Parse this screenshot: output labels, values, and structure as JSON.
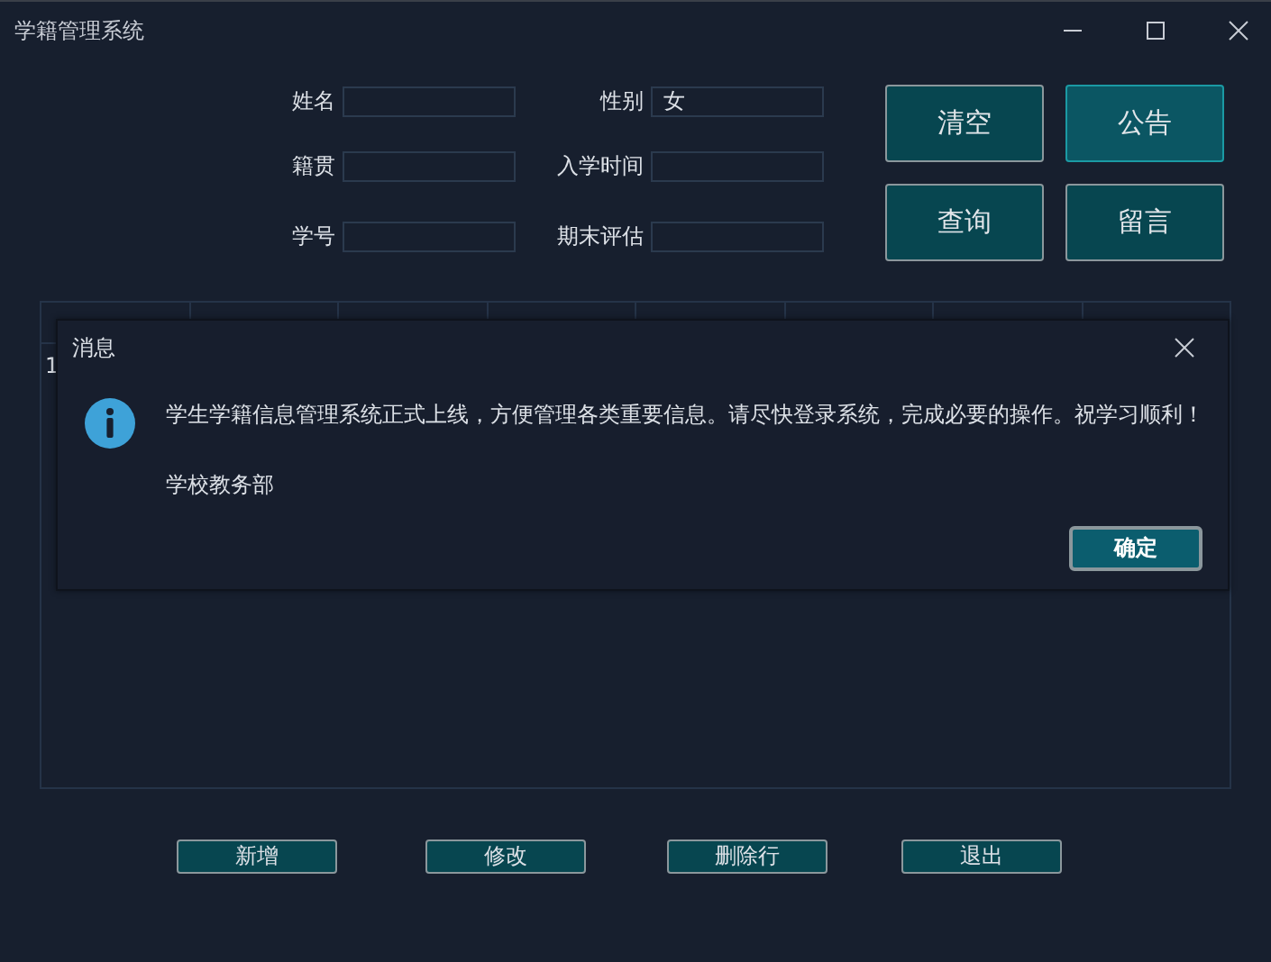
{
  "window": {
    "title": "学籍管理系统"
  },
  "form": [
    {
      "label": "姓名"
    },
    {
      "label": "性别",
      "value": "女"
    },
    {
      "label": "籍贯"
    },
    {
      "label": "入学时间"
    },
    {
      "label": "学号"
    },
    {
      "label": "期末评估"
    }
  ],
  "side_buttons": [
    {
      "label": "清空",
      "focused": false
    },
    {
      "label": "公告",
      "focused": true
    },
    {
      "label": "查询",
      "focused": false
    },
    {
      "label": "留言",
      "focused": false
    }
  ],
  "table": {
    "rows": [
      {
        "cells": [
          "1"
        ]
      }
    ]
  },
  "bottom_buttons": [
    "新增",
    "修改",
    "删除行",
    "退出"
  ],
  "dialog": {
    "title": "消息",
    "message": "学生学籍信息管理系统正式上线，方便管理各类重要信息。请尽快登录系统，完成必要的操作。祝学习顺利！",
    "signature": "学校教务部",
    "ok_button": "确定"
  }
}
